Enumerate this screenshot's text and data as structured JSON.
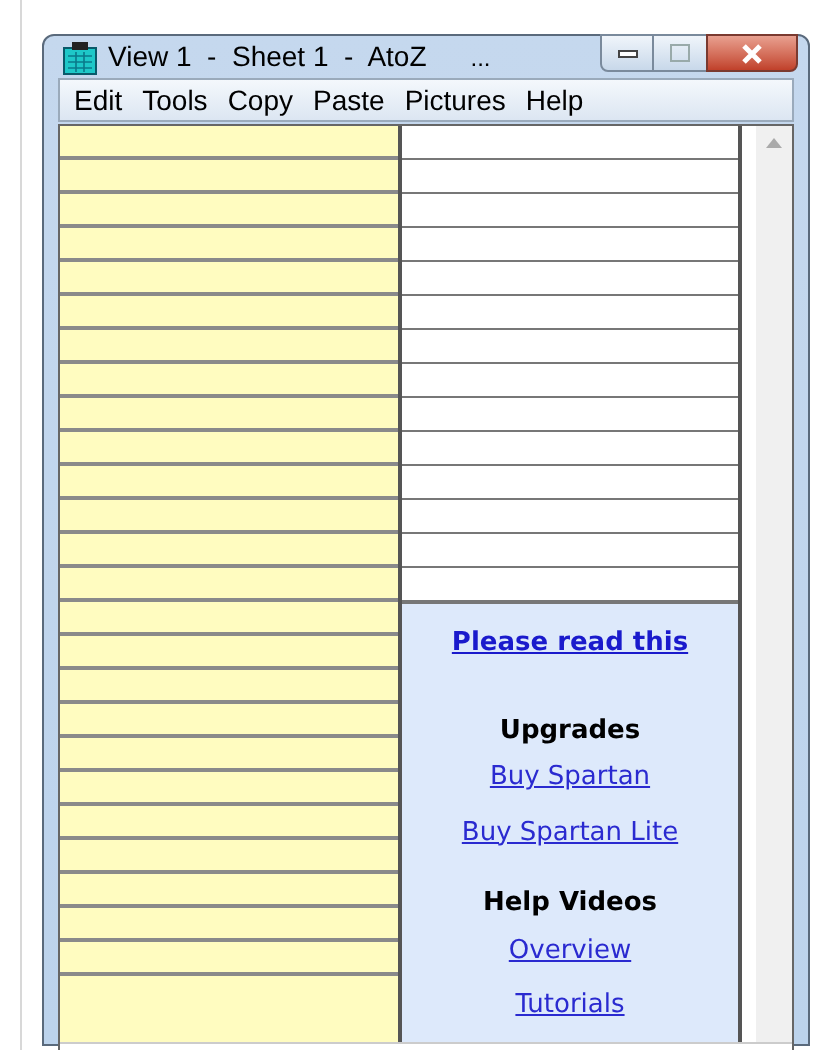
{
  "window": {
    "title": "View 1  -  Sheet 1  -  AtoZ",
    "title_overflow": "..."
  },
  "menu": [
    "Edit",
    "Tools",
    "Copy",
    "Paste",
    "Pictures",
    "Help"
  ],
  "help_panel": {
    "items": [
      {
        "kind": "main_link",
        "text": "Please read this"
      },
      {
        "kind": "heading",
        "text": "Upgrades"
      },
      {
        "kind": "link",
        "text": "Buy Spartan"
      },
      {
        "kind": "link",
        "text": "Buy Spartan Lite"
      },
      {
        "kind": "heading",
        "text": "Help Videos"
      },
      {
        "kind": "link",
        "text": "Overview"
      },
      {
        "kind": "link",
        "text": "Tutorials"
      }
    ]
  }
}
